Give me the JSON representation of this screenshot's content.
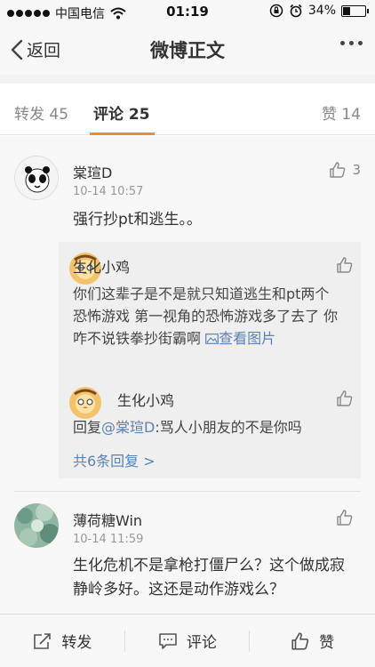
{
  "status_bar": {
    "carrier": "中国电信",
    "time": "01:19",
    "battery": "34%",
    "battery_level": 0.34
  },
  "nav": {
    "back_label": "返回",
    "title": "微博正文"
  },
  "tabs": {
    "repost": "转发 45",
    "comments": "评论 25",
    "likes": "赞 14"
  },
  "comments": [
    {
      "name": "棠瑄D",
      "time": "10-14 10:57",
      "text": "强行抄pt和逃生。。",
      "likes": "3",
      "replies": [
        {
          "name": "生化小鸡",
          "text": "你们这辈子是不是就只知道逃生和pt两个恐怖游戏 第一视角的恐怖游戏多了去了 你咋不说铁拳抄街霸啊",
          "link_label": "查看图片"
        },
        {
          "name": "生化小鸡",
          "reply_prefix": "回复",
          "mention": "@棠瑄D",
          "text": ":骂人小朋友的不是你吗"
        }
      ],
      "more_replies": "共6条回复 >"
    },
    {
      "name": "薄荷糖Win",
      "time": "10-14 11:59",
      "text": "生化危机不是拿枪打僵尸么？这个做成寂静岭多好。这还是动作游戏么？"
    }
  ],
  "toolbar": {
    "repost": "转发",
    "comment": "评论",
    "like": "赞"
  },
  "colors": {
    "accent": "#f28c23",
    "link": "#5b82b4"
  }
}
